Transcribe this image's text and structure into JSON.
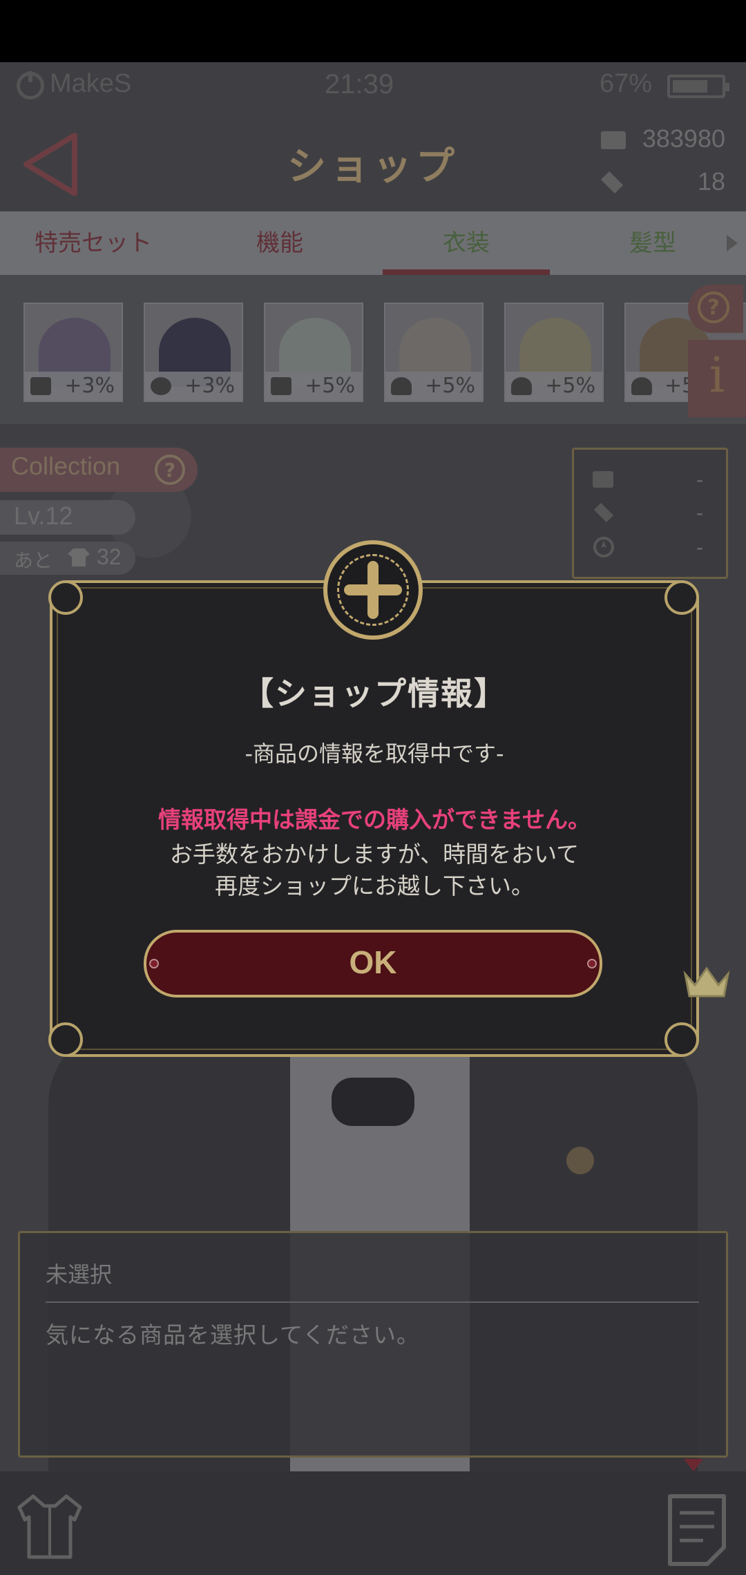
{
  "status_bar": {
    "brand": "MakeS",
    "time": "21:39",
    "battery": "67%"
  },
  "header": {
    "title": "ショップ",
    "currency1": "383980",
    "currency2": "18"
  },
  "tabs": [
    {
      "label": "特売セット",
      "color": "#7a3a42",
      "active": false
    },
    {
      "label": "機能",
      "color": "#7a3a42",
      "active": false
    },
    {
      "label": "衣装",
      "color": "#5a7a4a",
      "active": true
    },
    {
      "label": "髪型",
      "color": "#5a7a4a",
      "active": false
    }
  ],
  "items": [
    {
      "bonus": "+3%",
      "icon": "book-icon",
      "color": "#6a6078"
    },
    {
      "bonus": "+3%",
      "icon": "info-icon",
      "color": "#3e3e52"
    },
    {
      "bonus": "+5%",
      "icon": "book-icon",
      "color": "#8e9690"
    },
    {
      "bonus": "+5%",
      "icon": "heart-icon",
      "color": "#8a8682"
    },
    {
      "bonus": "+5%",
      "icon": "heart-icon",
      "color": "#8e8870"
    },
    {
      "bonus": "+5",
      "icon": "heart-icon",
      "color": "#7a6a56"
    }
  ],
  "collection": {
    "label": "Collection",
    "level": "Lv.12",
    "remain_label": "あと",
    "remain_count": "32"
  },
  "stats": [
    "-",
    "-",
    "-"
  ],
  "dialog": {
    "title": "【ショップ情報】",
    "subtitle": "-商品の情報を取得中です-",
    "warning": "情報取得中は課金での購入ができません。",
    "body_line1": "お手数をおかけしますが、時間をおいて",
    "body_line2": "再度ショップにお越し下さい。",
    "ok_label": "OK"
  },
  "description": {
    "title": "未選択",
    "text": "気になる商品を選択してください。"
  },
  "colors": {
    "accent_gold": "#b8a36a",
    "warning_pink": "#e8417a",
    "ok_button": "#4c1016"
  }
}
